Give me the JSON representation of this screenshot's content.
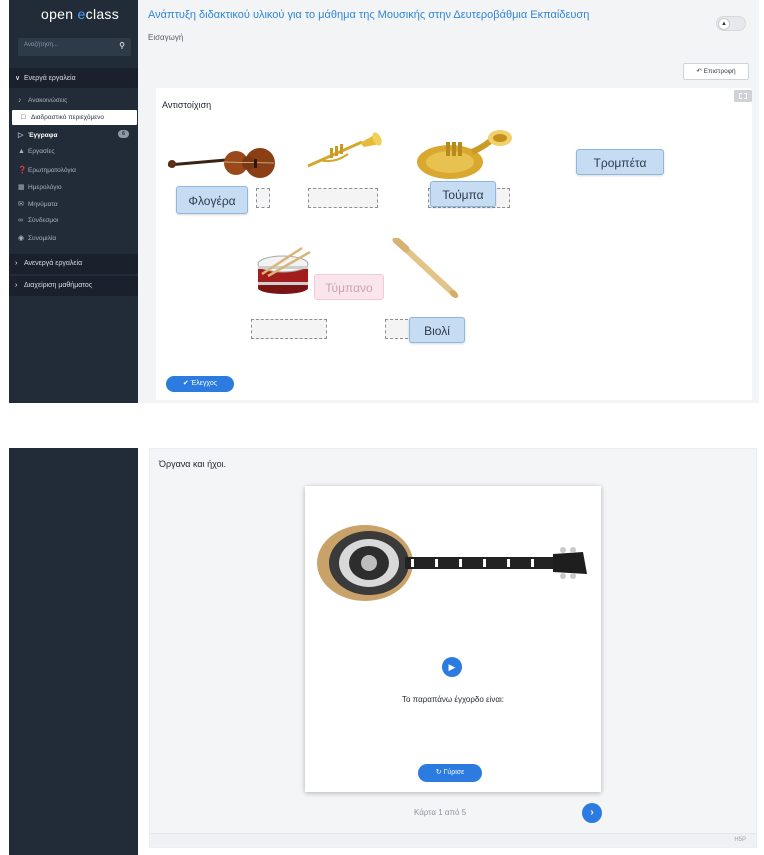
{
  "top": {
    "logo": {
      "prefix": "open ",
      "accent": "e",
      "suffix": "class"
    },
    "sidebar": {
      "search_placeholder": "Αναζήτηση...",
      "active_tools_label": "Ενεργά εργαλεία",
      "items": [
        {
          "label": "Ανακοινώσεις",
          "icon": "megaphone-icon"
        },
        {
          "label": "Διαδραστικό περιεχόμενο",
          "icon": "square-icon"
        },
        {
          "label": "Έγγραφα",
          "icon": "folder-icon",
          "badge": "6"
        },
        {
          "label": "Εργασίες",
          "icon": "flask-icon"
        },
        {
          "label": "Ερωτηματολόγια",
          "icon": "question-icon"
        },
        {
          "label": "Ημερολόγιο",
          "icon": "calendar-icon"
        },
        {
          "label": "Μηνύματα",
          "icon": "envelope-icon"
        },
        {
          "label": "Σύνδεσμοι",
          "icon": "link-icon"
        },
        {
          "label": "Συνομιλία",
          "icon": "chat-icon"
        }
      ],
      "inactive_tools_label": "Ανενεργά εργαλεία",
      "course_admin_label": "Διαχείριση μαθήματος"
    },
    "header": {
      "course_title": "Ανάπτυξη διδακτικού υλικού για το μάθημα της Μουσικής στην Δευτεροβάθμια Εκπαίδευση",
      "breadcrumb": "Εισαγωγή",
      "back_label": "Επιστροφή"
    },
    "activity": {
      "title": "Αντιστοίχιση",
      "images": [
        "violin-image",
        "trumpet-image",
        "tuba-image",
        "snare-drum-image",
        "recorder-image"
      ],
      "labels": {
        "flogera": "Φλογέρα",
        "touba": "Τούμπα",
        "trompeta": "Τρομπέτα",
        "tympano": "Τύμπανο",
        "violi": "Βιολί"
      },
      "check_label": "Έλεγχος"
    }
  },
  "bottom": {
    "section_title": "Όργανα και ήχοι.",
    "card_image": "mandolin-image",
    "question": "Το παραπάνω έγχορδο είναι:",
    "turn_label": "Γύρισε",
    "counter": "Κάρτα 1 από 5",
    "footer_brand": "H5P"
  },
  "colors": {
    "sidebar_bg": "#222b38",
    "accent_blue": "#2b7be0",
    "title_blue": "#2f86d8",
    "draggable_bg": "#c5dcf3"
  }
}
